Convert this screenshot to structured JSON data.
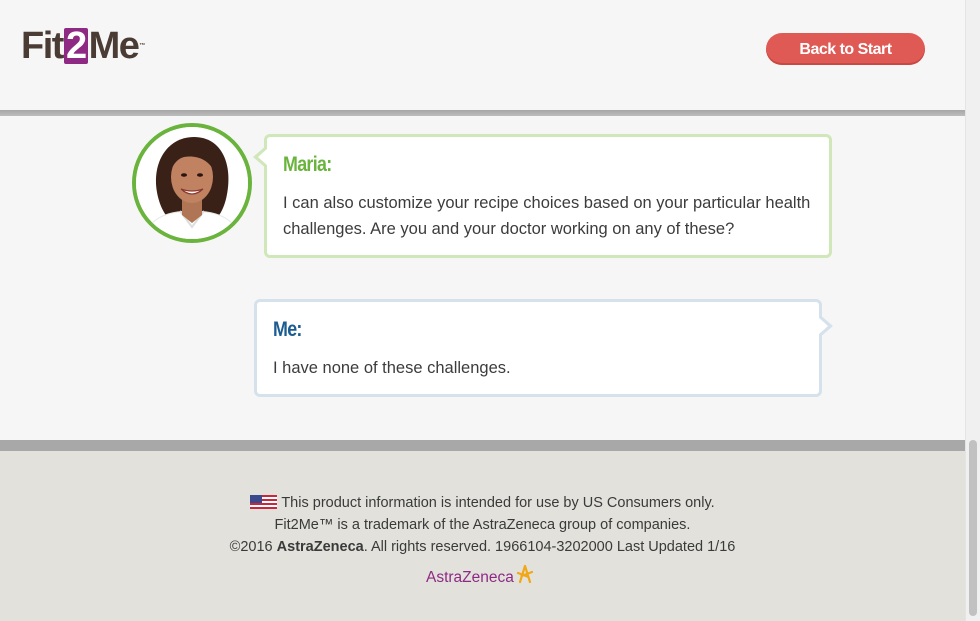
{
  "header": {
    "logo_prefix": "Fit",
    "logo_two": "2",
    "logo_suffix": "Me",
    "logo_tm": "™",
    "back_button_label": "Back to Start"
  },
  "chat": {
    "maria": {
      "speaker": "Maria:",
      "message": "I can also customize your recipe choices based on your particular health challenges. Are you and your doctor working on any of these?"
    },
    "me": {
      "speaker": "Me:",
      "message": "I have none of these challenges."
    }
  },
  "footer": {
    "line1": "This product information is intended for use by US Consumers only.",
    "line2_brand": "Fit2Me™",
    "line2_rest": " is a trademark of the AstraZeneca group of companies.",
    "line3_prefix": "©2016 ",
    "line3_brand": "AstraZeneca",
    "line3_rest": ". All rights reserved. 1966104-3202000 Last Updated 1/16",
    "az_logo_text": "AstraZeneca"
  },
  "colors": {
    "brand_purple": "#8e2a84",
    "button_red": "#e05a55",
    "maria_green": "#6ab43d",
    "me_blue": "#1b5d92",
    "footer_bg": "#e2e1dc"
  }
}
